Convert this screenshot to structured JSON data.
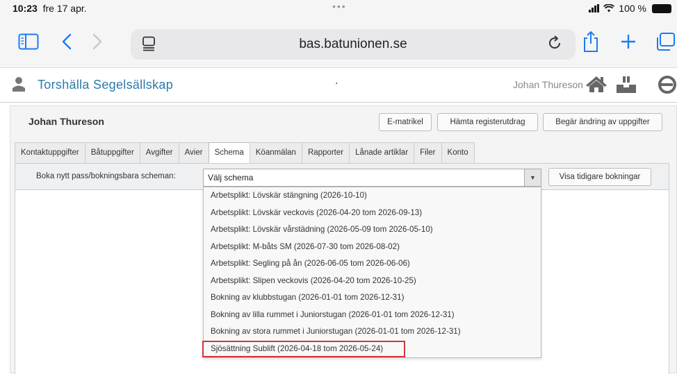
{
  "statusbar": {
    "time": "10:23",
    "date": "fre 17 apr.",
    "dots": "•••",
    "battery": "100 %"
  },
  "browser": {
    "url": "bas.batunionen.se"
  },
  "site": {
    "club_name": "Torshälla Segelsällskap",
    "separator": ".",
    "user_name": "Johan Thureson"
  },
  "member": {
    "name": "Johan Thureson",
    "buttons": {
      "ematrikel": "E-matrikel",
      "registerutdrag": "Hämta registerutdrag",
      "andring": "Begär ändring av uppgifter"
    }
  },
  "tabs": [
    "Kontaktuppgifter",
    "Båtuppgifter",
    "Avgifter",
    "Avier",
    "Schema",
    "Köanmälan",
    "Rapporter",
    "Lånade artiklar",
    "Filer",
    "Konto"
  ],
  "active_tab": "Schema",
  "schema": {
    "label": "Boka nytt pass/bokningsbara scheman:",
    "select_value": "Välj schema",
    "previous_button": "Visa tidigare bokningar",
    "options": [
      "Arbetsplikt: Lövskär stängning (2026-10-10)",
      "Arbetsplikt: Lövskär veckovis (2026-04-20 tom 2026-09-13)",
      "Arbetsplikt: Lövskär vårstädning (2026-05-09 tom 2026-05-10)",
      "Arbetsplikt: M-båts SM (2026-07-30 tom 2026-08-02)",
      "Arbetsplikt: Segling på ån (2026-06-05 tom 2026-06-06)",
      "Arbetsplikt: Slipen veckovis (2026-04-20 tom 2026-10-25)",
      "Bokning av klubbstugan (2026-01-01 tom 2026-12-31)",
      "Bokning av lilla rummet i Juniorstugan (2026-01-01 tom 2026-12-31)",
      "Bokning av stora rummet i Juniorstugan (2026-01-01 tom 2026-12-31)",
      "Sjösättning Sublift (2026-04-18 tom 2026-05-24)"
    ],
    "highlighted_option": "Sjösättning Sublift (2026-04-18 tom 2026-05-24)"
  },
  "colors": {
    "browser_accent": "#1a7cf2",
    "club_link": "#2a7aa8",
    "highlight_border": "#d4343b"
  },
  "icons": [
    "sidebar-icon",
    "back-icon",
    "forward-icon",
    "tab-overview-icon",
    "reload-icon",
    "share-icon",
    "new-tab-icon",
    "tabs-icon",
    "person-icon",
    "home-icon",
    "boat-icon",
    "logout-icon"
  ]
}
